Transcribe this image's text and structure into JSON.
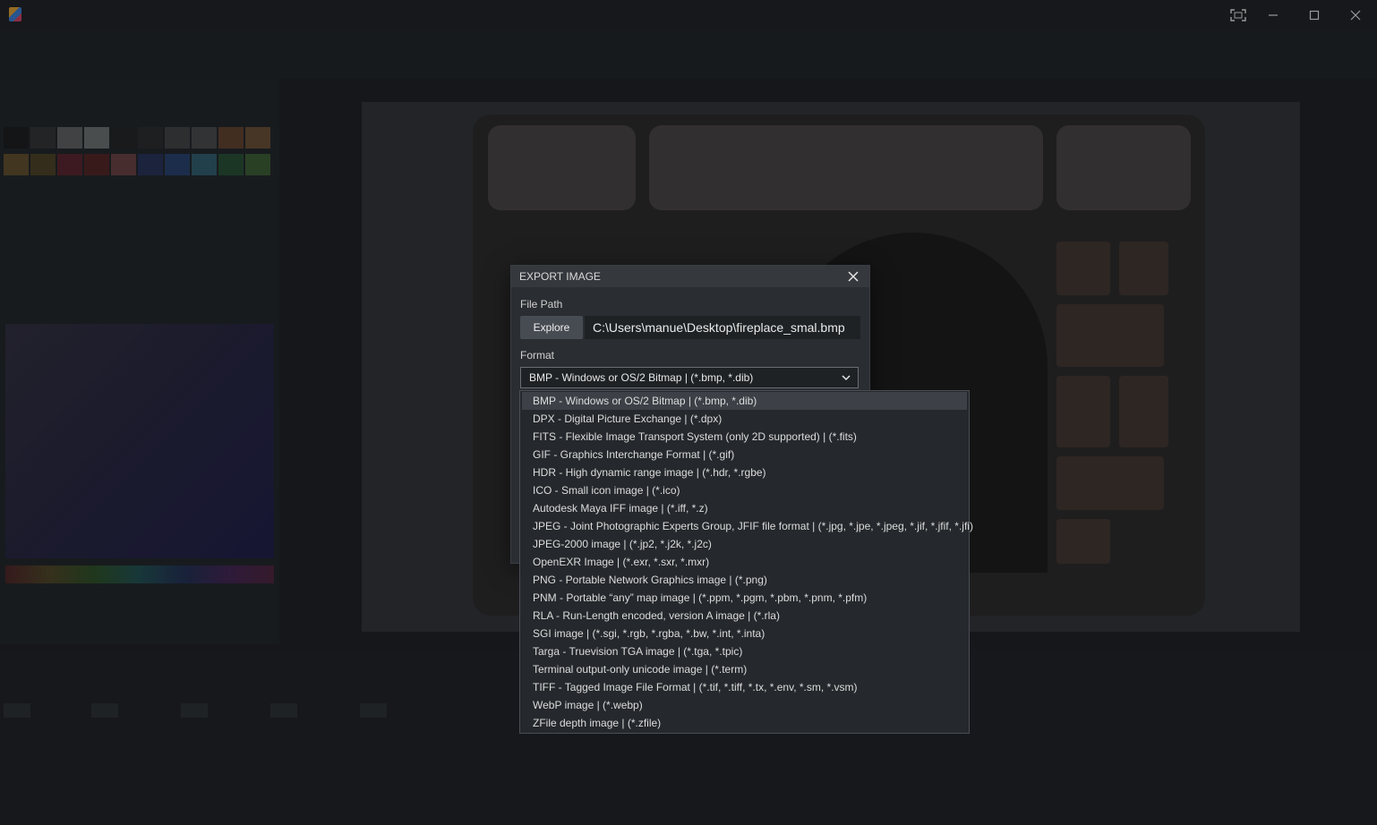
{
  "dialog": {
    "title": "EXPORT IMAGE",
    "file_path_label": "File Path",
    "explore_label": "Explore",
    "file_path_value": "C:\\Users\\manue\\Desktop\\fireplace_smal.bmp",
    "format_label": "Format",
    "format_selected": "BMP - Windows or OS/2 Bitmap | (*.bmp, *.dib)"
  },
  "format_options": [
    "BMP - Windows or OS/2 Bitmap | (*.bmp, *.dib)",
    "DPX - Digital Picture Exchange | (*.dpx)",
    "FITS - Flexible Image Transport System (only 2D supported) | (*.fits)",
    "GIF - Graphics Interchange Format | (*.gif)",
    "HDR - High dynamic range image | (*.hdr, *.rgbe)",
    "ICO - Small icon image | (*.ico)",
    "Autodesk Maya IFF image | (*.iff, *.z)",
    "JPEG - Joint Photographic Experts Group, JFIF file format | (*.jpg, *.jpe, *.jpeg, *.jif, *.jfif, *.jfi)",
    "JPEG-2000 image | (*.jp2, *.j2k, *.j2c)",
    "OpenEXR Image | (*.exr, *.sxr, *.mxr)",
    "PNG - Portable Network Graphics image | (*.png)",
    "PNM - Portable “any” map image | (*.ppm, *.pgm, *.pbm, *.pnm, *.pfm)",
    "RLA - Run-Length encoded, version A image | (*.rla)",
    "SGI image | (*.sgi, *.rgb, *.rgba, *.bw, *.int, *.inta)",
    "Targa - Truevision TGA image | (*.tga, *.tpic)",
    "Terminal output-only unicode image | (*.term)",
    "TIFF - Tagged Image File Format | (*.tif, *.tiff, *.tx, *.env, *.sm, *.vsm)",
    "WebP image | (*.webp)",
    "ZFile depth image | (*.zfile)"
  ],
  "icons": {
    "fullscreen": "fullscreen-icon",
    "minimize": "minimize-icon",
    "maximize": "maximize-icon",
    "close": "close-icon",
    "dropdown": "chevron-down-icon"
  },
  "colors": {
    "background": "#1c1e21",
    "dialog": "#2a2d31",
    "selected_option": "#3d4147"
  }
}
